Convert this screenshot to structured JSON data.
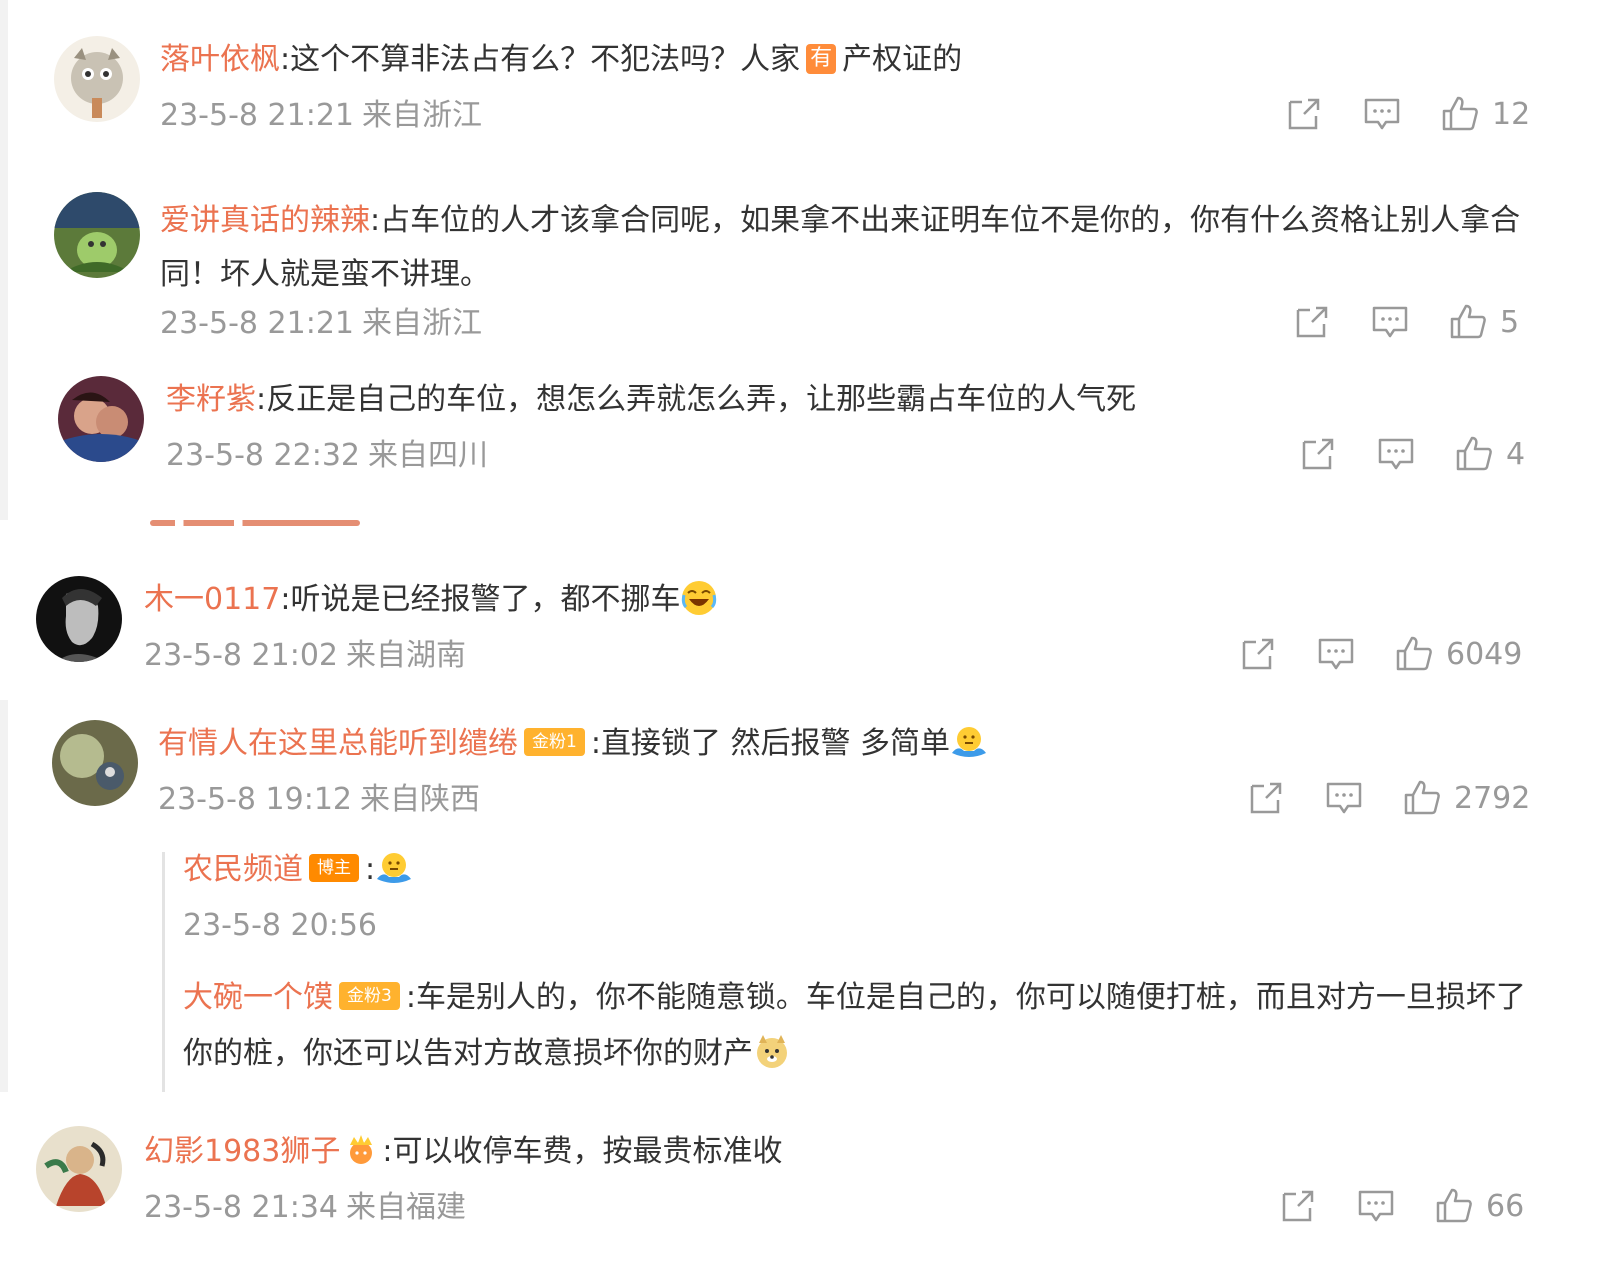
{
  "comments": [
    {
      "username": "落叶依枫",
      "text_before": "这个不算非法占有么？不犯法吗？人家",
      "inline_badge": "有",
      "text_after": "产权证的",
      "time": "23-5-8 21:21",
      "location": "来自浙江",
      "likes": "12"
    },
    {
      "username": "爱讲真话的辣辣",
      "text": "占车位的人才该拿合同呢，如果拿不出来证明车位不是你的，你有什么资格让别人拿合同！坏人就是蛮不讲理。",
      "time": "23-5-8 21:21",
      "location": "来自浙江",
      "likes": "5"
    },
    {
      "username": "李籽紫",
      "text": "反正是自己的车位，想怎么弄就怎么弄，让那些霸占车位的人气死",
      "time": "23-5-8 22:32",
      "location": "来自四川",
      "likes": "4"
    },
    {
      "username": "木一0117",
      "text": "听说是已经报警了，都不挪车",
      "emoji": "laugh-cry-emoji",
      "time": "23-5-8 21:02",
      "location": "来自湖南",
      "likes": "6049"
    },
    {
      "username": "有情人在这里总能听到缱绻",
      "badge": "金粉1",
      "text": "直接锁了 然后报警 多简单",
      "emoji": "shrug-emoji",
      "time": "23-5-8 19:12",
      "location": "来自陕西",
      "likes": "2792",
      "replies": [
        {
          "username": "农民频道",
          "badge": "博主",
          "text": "",
          "emoji": "shrug-emoji",
          "time": "23-5-8 20:56"
        },
        {
          "username": "大碗一个馍",
          "badge": "金粉3",
          "text": "车是别人的，你不能随意锁。车位是自己的，你可以随便打桩，而且对方一旦损坏了你的桩，你还可以告对方故意损坏你的财产",
          "emoji": "doge-emoji"
        }
      ]
    },
    {
      "username": "幻影1983狮子",
      "text": "可以收停车费，按最贵标准收",
      "time": "23-5-8 21:34",
      "location": "来自福建",
      "likes": "66"
    }
  ],
  "colors": {
    "username": "#eb7350",
    "text": "#333333",
    "meta": "#999999",
    "badge_orange": "#ff8c3a",
    "badge_gold": "#ffb22e"
  },
  "icons": [
    "share-icon",
    "comment-icon",
    "like-icon"
  ]
}
